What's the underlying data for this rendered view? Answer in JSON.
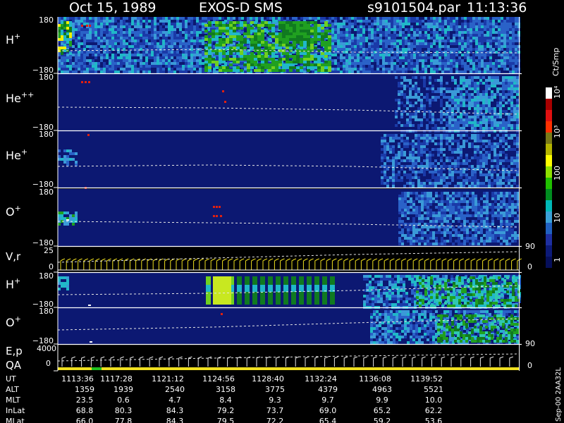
{
  "header": {
    "date": "Oct 15, 1989",
    "title": "EXOS-D SMS",
    "file": "s9101504.par",
    "time": "11:13:36"
  },
  "colorbar": {
    "unit": "Ct/Smp",
    "tick_labels": [
      "10⁴",
      "10³",
      "100",
      "10",
      "1"
    ],
    "colors": [
      "#ffffff",
      "#a80000",
      "#e01010",
      "#ff3000",
      "#7a7a18",
      "#b4b400",
      "#ffff00",
      "#8ee000",
      "#20c000",
      "#008c20",
      "#00b8b8",
      "#3aa0d8",
      "#2060c0",
      "#1e2fa0",
      "#0c1a78",
      "#060f5a"
    ]
  },
  "panels": [
    {
      "id": "h-plus",
      "species": "H",
      "charge": "+",
      "top": "180",
      "bottom": "−180"
    },
    {
      "id": "he-plusplus",
      "species": "He",
      "charge": "++",
      "top": "180",
      "bottom": "−180"
    },
    {
      "id": "he-plus",
      "species": "He",
      "charge": "+",
      "top": "180",
      "bottom": "−180"
    },
    {
      "id": "o-plus",
      "species": "O",
      "charge": "+",
      "top": "180",
      "bottom": "−180"
    },
    {
      "id": "v-r",
      "label": "V,r",
      "top": "25",
      "bottom": "0",
      "right_top": "90",
      "right_bottom": "0"
    },
    {
      "id": "h-plus-2",
      "species": "H",
      "charge": "+",
      "top": "180",
      "bottom": "−180"
    },
    {
      "id": "o-plus-2",
      "species": "O",
      "charge": "+",
      "top": "180",
      "bottom": "−180",
      "right_bottom": "90"
    },
    {
      "id": "e-p",
      "label": "E,p",
      "label2": "QA",
      "top": "4000",
      "bottom": "0",
      "right_bottom": "0"
    }
  ],
  "side_label": "Sep-00  2AA32L",
  "chart_data": {
    "type": "table",
    "title": "Oct 15, 1989   EXOS-D SMS",
    "rows": [
      {
        "name": "UT",
        "values": [
          "1113:36",
          "1117:28",
          "1121:12",
          "1124:56",
          "1128:40",
          "1132:24",
          "1136:08",
          "1139:52"
        ]
      },
      {
        "name": "ALT",
        "values": [
          "1359",
          "1939",
          "2540",
          "3158",
          "3775",
          "4379",
          "4963",
          "5521"
        ]
      },
      {
        "name": "MLT",
        "values": [
          "23.5",
          "0.6",
          "4.7",
          "8.4",
          "9.3",
          "9.7",
          "9.9",
          "10.0"
        ]
      },
      {
        "name": "InLat",
        "values": [
          "68.8",
          "80.3",
          "84.3",
          "79.2",
          "73.7",
          "69.0",
          "65.2",
          "62.2"
        ]
      },
      {
        "name": "MLat",
        "values": [
          "66.0",
          "77.8",
          "84.3",
          "79.5",
          "72.2",
          "65.4",
          "59.2",
          "53.6"
        ]
      }
    ]
  }
}
